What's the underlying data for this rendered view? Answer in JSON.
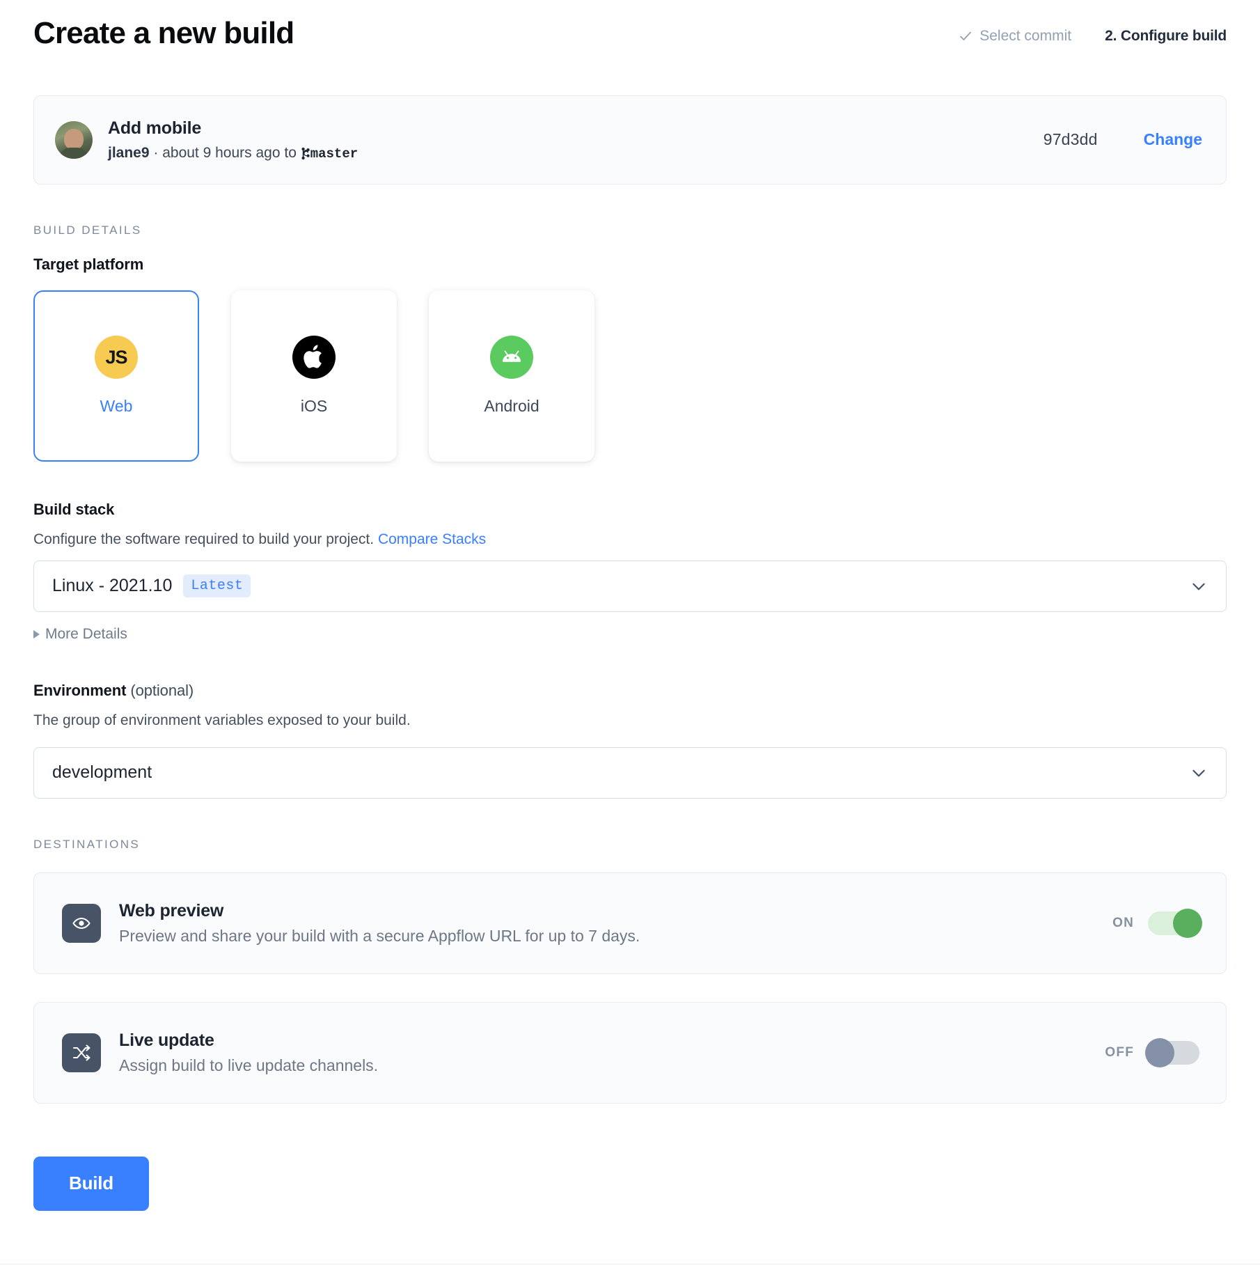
{
  "header": {
    "title": "Create a new build",
    "steps": [
      {
        "label": "Select commit",
        "state": "done",
        "icon": "check-icon"
      },
      {
        "label": "2. Configure build",
        "state": "current"
      }
    ]
  },
  "commit": {
    "message": "Add mobile",
    "author": "jlane9",
    "separator": " · ",
    "time": "about 9 hours ago to ",
    "branch": "master",
    "branch_icon": "git-branch-icon",
    "hash": "97d3dd",
    "change_label": "Change",
    "avatar_icon": "avatar"
  },
  "build_details": {
    "section_label": "BUILD DETAILS",
    "target_platform": {
      "label": "Target platform",
      "selected": "Web",
      "options": [
        {
          "label": "Web",
          "icon": "js-icon",
          "selected": true
        },
        {
          "label": "iOS",
          "icon": "apple-icon",
          "selected": false
        },
        {
          "label": "Android",
          "icon": "android-icon",
          "selected": false
        }
      ]
    },
    "build_stack": {
      "label": "Build stack",
      "help_text": "Configure the software required to build your project. ",
      "help_link": "Compare Stacks",
      "value": "Linux - 2021.10",
      "badge": "Latest",
      "more_details": "More Details"
    },
    "environment": {
      "label": "Environment",
      "optional": " (optional)",
      "help_text": "The group of environment variables exposed to your build.",
      "value": "development"
    }
  },
  "destinations": {
    "section_label": "DESTINATIONS",
    "items": [
      {
        "title": "Web preview",
        "subtitle": "Preview and share your build with a secure Appflow URL for up to 7 days.",
        "icon": "eye-icon",
        "toggle_label": "ON",
        "toggle_state": "on"
      },
      {
        "title": "Live update",
        "subtitle": "Assign build to live update channels.",
        "icon": "shuffle-icon",
        "toggle_label": "OFF",
        "toggle_state": "off"
      }
    ]
  },
  "footer": {
    "build_label": "Build"
  },
  "colors": {
    "accent": "#3880ff",
    "toggle_on": "#5aaf5e",
    "toggle_off": "#8491a8",
    "js_yellow": "#f7ca51",
    "android_green": "#5ccb5f",
    "card_bg": "#fafbfc"
  }
}
